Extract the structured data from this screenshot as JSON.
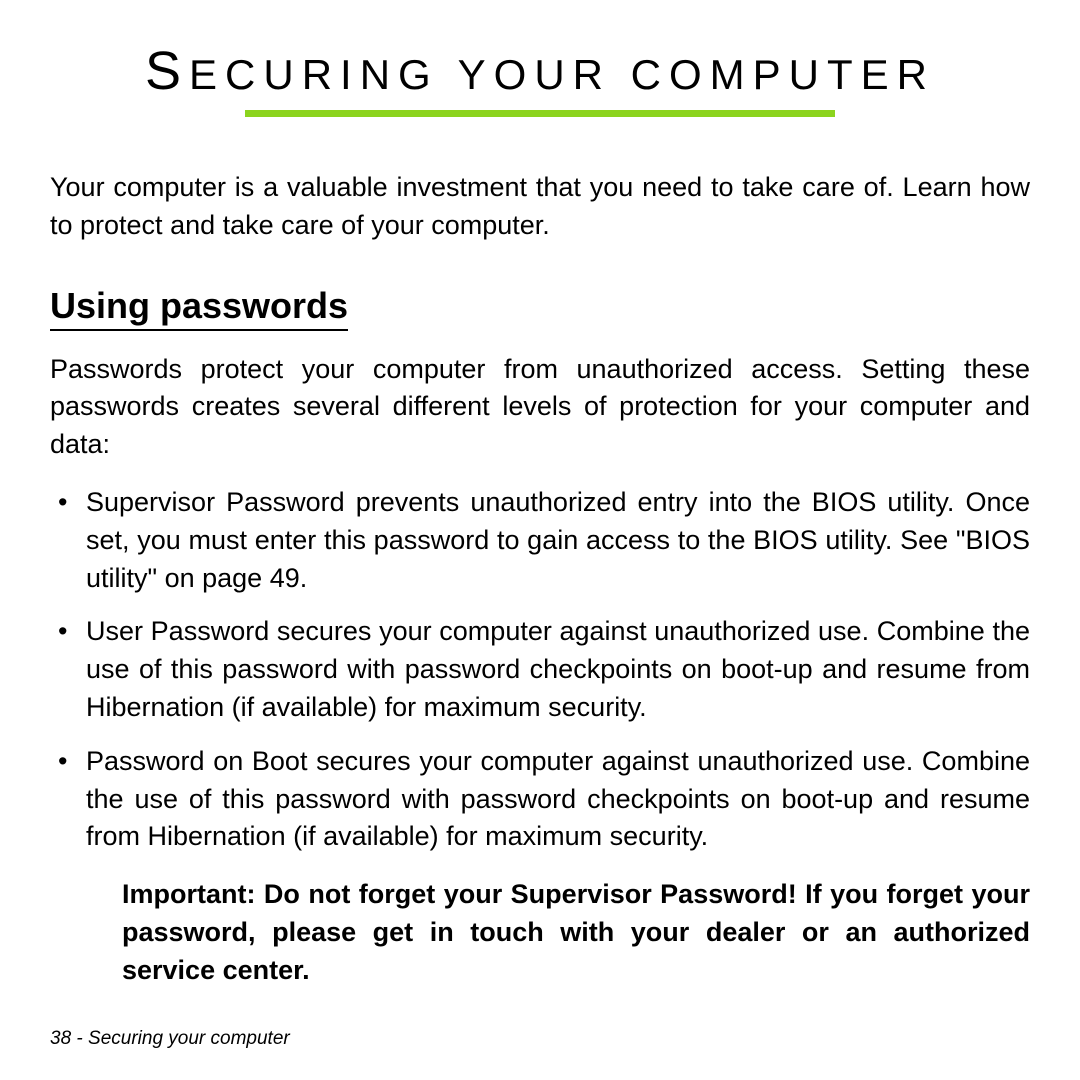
{
  "title_first": "S",
  "title_rest": "ECURING YOUR COMPUTER",
  "intro": "Your computer is a valuable investment that you need to take care of. Learn how to protect and take care of your computer.",
  "section_heading": "Using passwords",
  "section_intro": "Passwords protect your computer from unauthorized access. Setting these passwords creates several different levels of protection for your computer and data:",
  "bullets": [
    "Supervisor Password prevents unauthorized entry into the BIOS utility. Once set, you must enter this password to gain access to the BIOS utility. See \"BIOS utility\" on page 49.",
    "User Password secures your computer against unauthorized use. Combine the use of this password with password checkpoints on boot-up and resume from Hibernation (if available) for maximum security.",
    "Password on Boot secures your computer against unauthorized use. Combine the use of this password with password checkpoints on boot-up and resume from Hibernation (if available) for maximum security."
  ],
  "important": "Important: Do not forget your Supervisor Password! If you forget your password, please get in touch with your dealer or an authorized service center.",
  "footer": "38 - Securing your computer"
}
